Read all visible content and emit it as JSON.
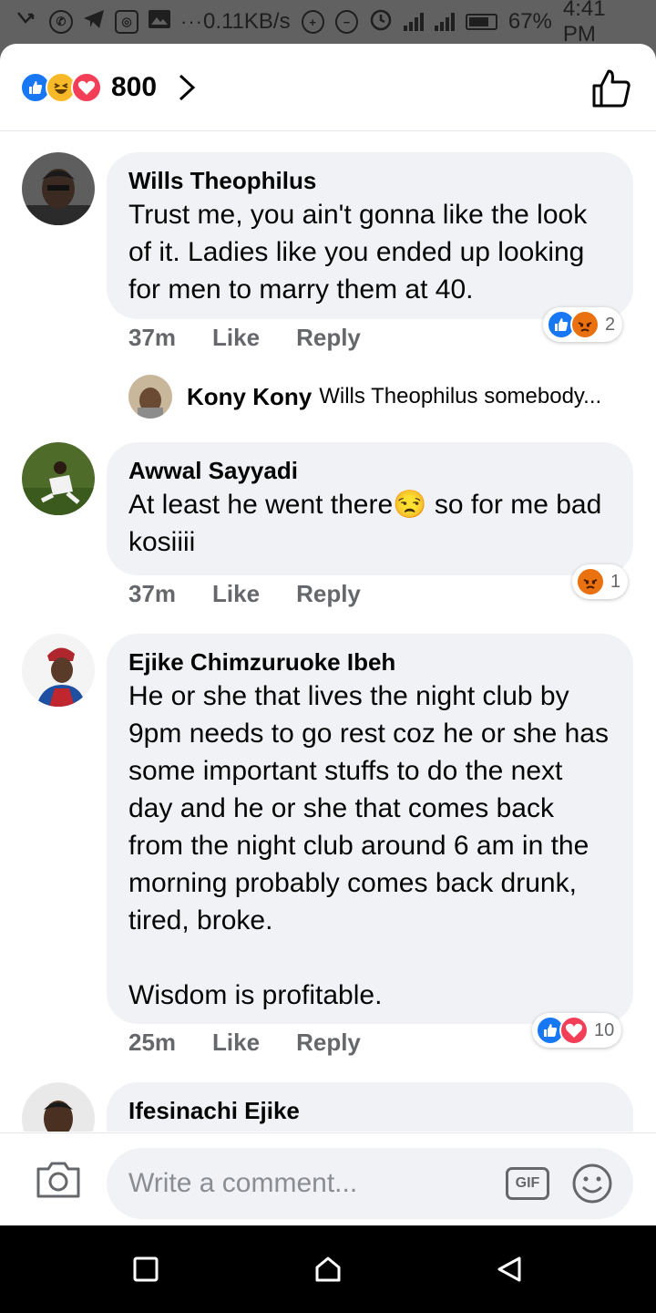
{
  "status_bar": {
    "speed": "0.11KB/s",
    "battery": "67%",
    "time": "4:41 PM",
    "more": "···"
  },
  "header": {
    "reaction_count": "800",
    "reactions": [
      "like",
      "haha",
      "love"
    ]
  },
  "comments": [
    {
      "author": "Wills Theophilus",
      "text": "Trust me, you ain't gonna like the look of it. Ladies like you ended up looking for men to marry them at 40.",
      "time": "37m",
      "like_label": "Like",
      "reply_label": "Reply",
      "reaction_count": "2",
      "reactions": [
        "like",
        "angry"
      ],
      "reply": {
        "author": "Kony Kony",
        "text": "Wills Theophilus somebody..."
      }
    },
    {
      "author": "Awwal Sayyadi",
      "text": "At least he went there😒 so for me bad  kosiiii",
      "time": "37m",
      "like_label": "Like",
      "reply_label": "Reply",
      "reaction_count": "1",
      "reactions": [
        "angry"
      ]
    },
    {
      "author": "Ejike Chimzuruoke Ibeh",
      "text": "He or she that lives the night club by 9pm needs to go rest coz he or she has some important stuffs to do the next day and he or she that comes back from the night club around 6 am in the morning probably comes back drunk, tired, broke.\n\nWisdom is profitable.",
      "time": "25m",
      "like_label": "Like",
      "reply_label": "Reply",
      "reaction_count": "10",
      "reactions": [
        "like",
        "love"
      ]
    },
    {
      "author": "Ifesinachi Ejike"
    }
  ],
  "composer": {
    "placeholder": "Write a comment...",
    "gif_label": "GIF"
  },
  "colors": {
    "like": "#1877f2",
    "haha": "#f7b928",
    "love": "#f33e58",
    "angry": "#e9710f",
    "bubble": "#f0f2f5",
    "meta": "#65676b"
  }
}
